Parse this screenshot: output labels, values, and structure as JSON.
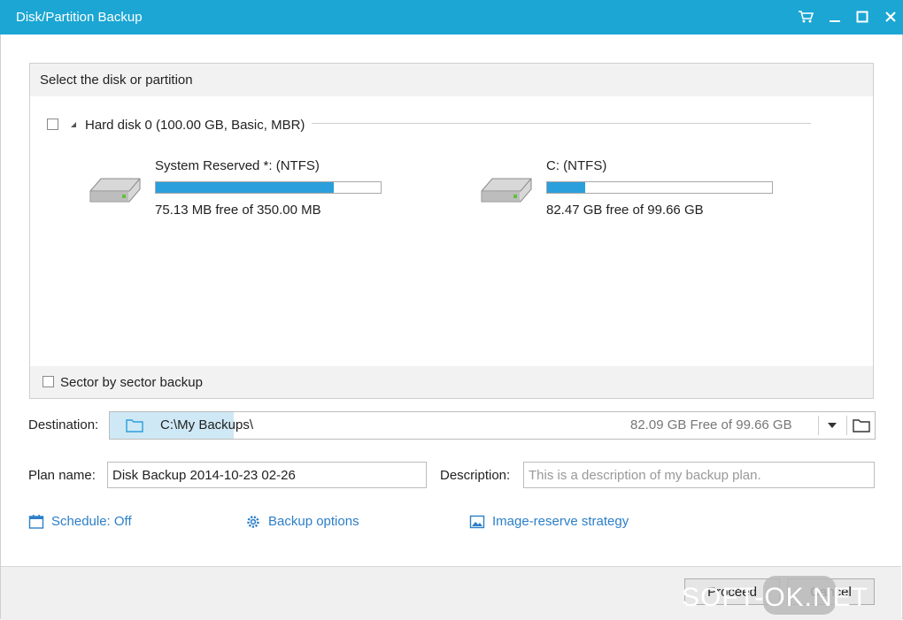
{
  "window": {
    "title": "Disk/Partition Backup"
  },
  "panel": {
    "header": "Select the disk or partition",
    "disk_label": "Hard disk 0 (100.00 GB, Basic, MBR)",
    "partitions": [
      {
        "name": "System Reserved *: (NTFS)",
        "free_text": "75.13 MB free of 350.00 MB",
        "used_fraction": 0.79
      },
      {
        "name": "C: (NTFS)",
        "free_text": "82.47 GB free of 99.66 GB",
        "used_fraction": 0.17
      }
    ],
    "sector_backup_label": "Sector by sector backup"
  },
  "destination": {
    "label": "Destination:",
    "path": "C:\\My Backups\\",
    "free": "82.09 GB Free of 99.66 GB"
  },
  "plan": {
    "label": "Plan name:",
    "value": "Disk Backup 2014-10-23 02-26"
  },
  "description": {
    "label": "Description:",
    "placeholder": "This is a description of my backup plan."
  },
  "links": {
    "schedule": "Schedule: Off",
    "backup_options": "Backup options",
    "image_reserve": "Image-reserve strategy"
  },
  "buttons": {
    "proceed": "Proceed",
    "cancel": "Cancel"
  },
  "watermark": "SOFT-OK.NET",
  "colors": {
    "titlebar": "#1ba6d4",
    "accent": "#2a9fdb",
    "link": "#2c7fc8"
  }
}
